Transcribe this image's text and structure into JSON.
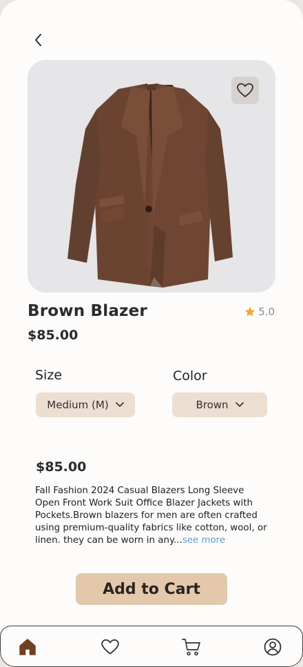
{
  "product": {
    "name": "Brown Blazer",
    "price": "$85.00",
    "rating": "5.0",
    "description_price": "$85.00",
    "description": "Fall Fashion 2024 Casual Blazers Long Sleeve Open Front Work Suit Office Blazer Jackets with Pockets.Brown blazers for men are often crafted using premium-quality fabrics like cotton, wool, or linen. they can be worn in any...",
    "see_more": "see more"
  },
  "options": {
    "size_label": "Size",
    "size_value": "Medium (M)",
    "color_label": "Color",
    "color_value": "Brown"
  },
  "actions": {
    "add_to_cart": "Add to Cart"
  },
  "icons": {
    "back": "chevron-left-icon",
    "favorite": "heart-outline-icon",
    "rating_star": "star-icon",
    "dropdown": "chevron-down-icon",
    "tab_home": "home-icon",
    "tab_favorites": "heart-outline-icon",
    "tab_cart": "cart-icon",
    "tab_profile": "user-circle-icon"
  },
  "colors": {
    "accent": "#e3c8ab",
    "select_bg": "#ecdfd1",
    "active_tab": "#6e4024",
    "star": "#f2a93b",
    "link": "#5b9bd8",
    "product_bg": "#e6e5e7"
  }
}
